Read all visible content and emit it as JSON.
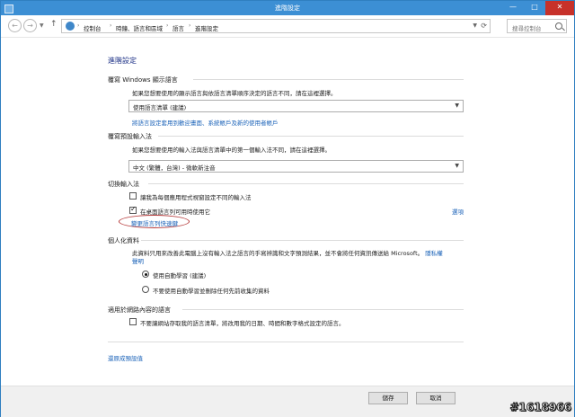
{
  "window": {
    "title": "進階設定"
  },
  "titlebar": {
    "min": "—",
    "max": "□",
    "close": "✕"
  },
  "toolbar": {
    "back": "←",
    "forward": "→",
    "up": "↑",
    "breadcrumb": [
      "控制台",
      "時鐘、語言和區域",
      "語言",
      "進階設定"
    ],
    "search_placeholder": "搜尋控制台"
  },
  "page": {
    "title": "進階設定"
  },
  "display_language": {
    "title": "覆寫 Windows 顯示語言",
    "desc": "如果您想要使用的顯示語言與依語言清單順序決定的語言不同，請在這裡選擇。",
    "select_value": "使用語言清單 (建議)",
    "link": "將語言設定套用到歡迎畫面、系統帳戶及新的使用者帳戶"
  },
  "default_input": {
    "title": "覆寫預設輸入法",
    "desc": "如果您想要使用的輸入法與語言清單中的第一個輸入法不同，請在這裡選擇。",
    "select_value": "中文 (繁體，台灣) - 微軟新注音"
  },
  "switch_input": {
    "title": "切換輸入法",
    "option1": "讓我為每個應用程式視窗設定不同的輸入法",
    "option2": "在桌面語言列可用時使用它",
    "option2_link": "選項",
    "hotkey_link": "變更語言列快速鍵"
  },
  "personalization": {
    "title": "個人化資料",
    "desc_line1": "此資料只用來改善此電腦上沒有輸入法之語言的手寫辨識和文字預測結果，並不會將任何資訊傳送給 Microsoft。",
    "desc_link_part1": "隱私權",
    "desc_link_part2": "聲明",
    "radio1": "使用自動學習 (建議)",
    "radio2": "不要使用自動學習並刪除任何先前收集的資料"
  },
  "web_content": {
    "title": "適用於網路內容的語言",
    "option": "不要讓網站存取我的語言清單，將改用我的日期、時間和數字格式設定的語言。"
  },
  "restore_link": "還原成預設值",
  "footer": {
    "save": "儲存",
    "cancel": "取消"
  },
  "watermark": "#1618966"
}
